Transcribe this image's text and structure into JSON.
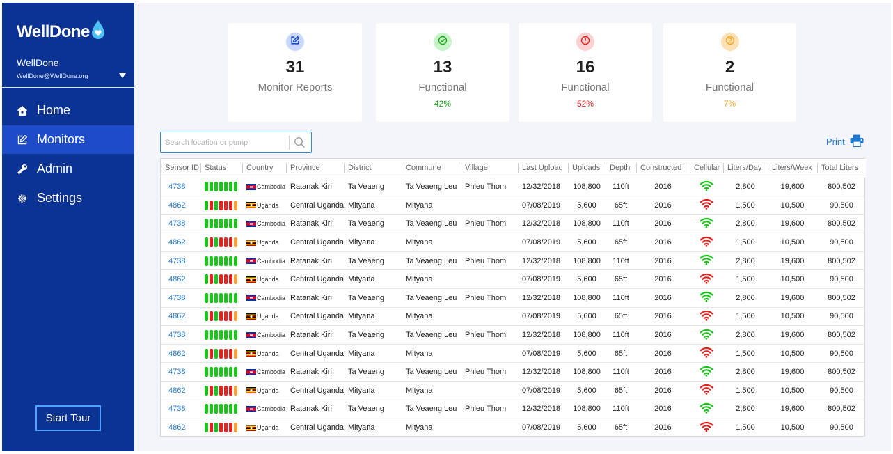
{
  "app": {
    "logo_text": "WellDone",
    "user_name": "WellDone",
    "user_email": "WellDone@WellDone.org"
  },
  "nav": [
    {
      "label": "Home",
      "icon": "home-icon",
      "active": false
    },
    {
      "label": "Monitors",
      "icon": "edit-icon",
      "active": true
    },
    {
      "label": "Admin",
      "icon": "wrench-icon",
      "active": false
    },
    {
      "label": "Settings",
      "icon": "gear-icon",
      "active": false
    }
  ],
  "start_tour": "Start Tour",
  "cards": [
    {
      "number": "31",
      "label": "Monitor Reports",
      "pct": "",
      "icon": "edit-icon",
      "badge_bg": "#c9d8fb",
      "icon_color": "#1e4bc7",
      "pct_color": "#777777"
    },
    {
      "number": "13",
      "label": "Functional",
      "pct": "42%",
      "icon": "check-circle-icon",
      "badge_bg": "#c8f5c8",
      "icon_color": "#1ca81c",
      "pct_color": "#1ca81c"
    },
    {
      "number": "16",
      "label": "Functional",
      "pct": "52%",
      "icon": "alert-circle-icon",
      "badge_bg": "#fbd1d1",
      "icon_color": "#e02020",
      "pct_color": "#e02020"
    },
    {
      "number": "2",
      "label": "Functional",
      "pct": "7%",
      "icon": "question-circle-icon",
      "badge_bg": "#fde0b3",
      "icon_color": "#f5a623",
      "pct_color": "#f5a623"
    }
  ],
  "search": {
    "placeholder": "Search location or pump"
  },
  "print_label": "Print",
  "colors": {
    "green": "#1cc41c",
    "red": "#e3231f",
    "orange": "#f7a23a",
    "link": "#1f78d1"
  },
  "table": {
    "headers": [
      "Sensor ID",
      "Status",
      "Country",
      "Province",
      "District",
      "Commune",
      "Village",
      "Last Upload",
      "Uploads",
      "Depth",
      "Constructed",
      "Cellular",
      "Liters/Day",
      "Liters/Week",
      "Total Liters"
    ],
    "rows": [
      {
        "sensor": "4738",
        "status": [
          "g",
          "g",
          "g",
          "g",
          "g",
          "g",
          "g"
        ],
        "flag": "cambodia",
        "country": "Cambodia",
        "province": "Ratanak Kiri",
        "district": "Ta Veaeng",
        "commune": "Ta Veaeng Leu",
        "village": "Phleu Thom",
        "last_upload": "12/32/2018",
        "uploads": "108,800",
        "depth": "110ft",
        "constructed": "2016",
        "cellular": "good",
        "liters_day": "2,800",
        "liters_week": "19,600",
        "total": "800,502"
      },
      {
        "sensor": "4862",
        "status": [
          "g",
          "r",
          "g",
          "r",
          "r",
          "r",
          "o"
        ],
        "flag": "uganda",
        "country": "Uganda",
        "province": "Central Uganda",
        "district": "Mityana",
        "commune": "Mityana",
        "village": "",
        "last_upload": "07/08/2019",
        "uploads": "5,600",
        "depth": "65ft",
        "constructed": "2016",
        "cellular": "poor",
        "liters_day": "1,500",
        "liters_week": "10,500",
        "total": "90,500"
      },
      {
        "sensor": "4738",
        "status": [
          "g",
          "g",
          "g",
          "g",
          "g",
          "g",
          "g"
        ],
        "flag": "cambodia",
        "country": "Cambodia",
        "province": "Ratanak Kiri",
        "district": "Ta Veaeng",
        "commune": "Ta Veaeng Leu",
        "village": "Phleu Thom",
        "last_upload": "12/32/2018",
        "uploads": "108,800",
        "depth": "110ft",
        "constructed": "2016",
        "cellular": "good",
        "liters_day": "2,800",
        "liters_week": "19,600",
        "total": "800,502"
      },
      {
        "sensor": "4862",
        "status": [
          "g",
          "r",
          "g",
          "r",
          "r",
          "r",
          "o"
        ],
        "flag": "uganda",
        "country": "Uganda",
        "province": "Central Uganda",
        "district": "Mityana",
        "commune": "Mityana",
        "village": "",
        "last_upload": "07/08/2019",
        "uploads": "5,600",
        "depth": "65ft",
        "constructed": "2016",
        "cellular": "poor",
        "liters_day": "1,500",
        "liters_week": "10,500",
        "total": "90,500"
      },
      {
        "sensor": "4738",
        "status": [
          "g",
          "g",
          "g",
          "g",
          "g",
          "g",
          "g"
        ],
        "flag": "cambodia",
        "country": "Cambodia",
        "province": "Ratanak Kiri",
        "district": "Ta Veaeng",
        "commune": "Ta Veaeng Leu",
        "village": "Phleu Thom",
        "last_upload": "12/32/2018",
        "uploads": "108,800",
        "depth": "110ft",
        "constructed": "2016",
        "cellular": "good",
        "liters_day": "2,800",
        "liters_week": "19,600",
        "total": "800,502"
      },
      {
        "sensor": "4862",
        "status": [
          "g",
          "r",
          "g",
          "r",
          "r",
          "r",
          "o"
        ],
        "flag": "uganda",
        "country": "Uganda",
        "province": "Central Uganda",
        "district": "Mityana",
        "commune": "Mityana",
        "village": "",
        "last_upload": "07/08/2019",
        "uploads": "5,600",
        "depth": "65ft",
        "constructed": "2016",
        "cellular": "poor",
        "liters_day": "1,500",
        "liters_week": "10,500",
        "total": "90,500"
      },
      {
        "sensor": "4738",
        "status": [
          "g",
          "g",
          "g",
          "g",
          "g",
          "g",
          "g"
        ],
        "flag": "cambodia",
        "country": "Cambodia",
        "province": "Ratanak Kiri",
        "district": "Ta Veaeng",
        "commune": "Ta Veaeng Leu",
        "village": "Phleu Thom",
        "last_upload": "12/32/2018",
        "uploads": "108,800",
        "depth": "110ft",
        "constructed": "2016",
        "cellular": "good",
        "liters_day": "2,800",
        "liters_week": "19,600",
        "total": "800,502"
      },
      {
        "sensor": "4862",
        "status": [
          "g",
          "r",
          "g",
          "r",
          "r",
          "r",
          "o"
        ],
        "flag": "uganda",
        "country": "Uganda",
        "province": "Central Uganda",
        "district": "Mityana",
        "commune": "Mityana",
        "village": "",
        "last_upload": "07/08/2019",
        "uploads": "5,600",
        "depth": "65ft",
        "constructed": "2016",
        "cellular": "poor",
        "liters_day": "1,500",
        "liters_week": "10,500",
        "total": "90,500"
      },
      {
        "sensor": "4738",
        "status": [
          "g",
          "g",
          "g",
          "g",
          "g",
          "g",
          "g"
        ],
        "flag": "cambodia",
        "country": "Cambodia",
        "province": "Ratanak Kiri",
        "district": "Ta Veaeng",
        "commune": "Ta Veaeng Leu",
        "village": "Phleu Thom",
        "last_upload": "12/32/2018",
        "uploads": "108,800",
        "depth": "110ft",
        "constructed": "2016",
        "cellular": "good",
        "liters_day": "2,800",
        "liters_week": "19,600",
        "total": "800,502"
      },
      {
        "sensor": "4862",
        "status": [
          "g",
          "r",
          "g",
          "r",
          "r",
          "r",
          "o"
        ],
        "flag": "uganda",
        "country": "Uganda",
        "province": "Central Uganda",
        "district": "Mityana",
        "commune": "Mityana",
        "village": "",
        "last_upload": "07/08/2019",
        "uploads": "5,600",
        "depth": "65ft",
        "constructed": "2016",
        "cellular": "poor",
        "liters_day": "1,500",
        "liters_week": "10,500",
        "total": "90,500"
      },
      {
        "sensor": "4738",
        "status": [
          "g",
          "g",
          "g",
          "g",
          "g",
          "g",
          "g"
        ],
        "flag": "cambodia",
        "country": "Cambodia",
        "province": "Ratanak Kiri",
        "district": "Ta Veaeng",
        "commune": "Ta Veaeng Leu",
        "village": "Phleu Thom",
        "last_upload": "12/32/2018",
        "uploads": "108,800",
        "depth": "110ft",
        "constructed": "2016",
        "cellular": "good",
        "liters_day": "2,800",
        "liters_week": "19,600",
        "total": "800,502"
      },
      {
        "sensor": "4862",
        "status": [
          "g",
          "r",
          "g",
          "r",
          "r",
          "r",
          "o"
        ],
        "flag": "uganda",
        "country": "Uganda",
        "province": "Central Uganda",
        "district": "Mityana",
        "commune": "Mityana",
        "village": "",
        "last_upload": "07/08/2019",
        "uploads": "5,600",
        "depth": "65ft",
        "constructed": "2016",
        "cellular": "poor",
        "liters_day": "1,500",
        "liters_week": "10,500",
        "total": "90,500"
      },
      {
        "sensor": "4738",
        "status": [
          "g",
          "g",
          "g",
          "g",
          "g",
          "g",
          "g"
        ],
        "flag": "cambodia",
        "country": "Cambodia",
        "province": "Ratanak Kiri",
        "district": "Ta Veaeng",
        "commune": "Ta Veaeng Leu",
        "village": "Phleu Thom",
        "last_upload": "12/32/2018",
        "uploads": "108,800",
        "depth": "110ft",
        "constructed": "2016",
        "cellular": "good",
        "liters_day": "2,800",
        "liters_week": "19,600",
        "total": "800,502"
      },
      {
        "sensor": "4862",
        "status": [
          "g",
          "r",
          "g",
          "r",
          "r",
          "r",
          "o"
        ],
        "flag": "uganda",
        "country": "Uganda",
        "province": "Central Uganda",
        "district": "Mityana",
        "commune": "Mityana",
        "village": "",
        "last_upload": "07/08/2019",
        "uploads": "5,600",
        "depth": "65ft",
        "constructed": "2016",
        "cellular": "poor",
        "liters_day": "1,500",
        "liters_week": "10,500",
        "total": "90,500"
      }
    ]
  }
}
